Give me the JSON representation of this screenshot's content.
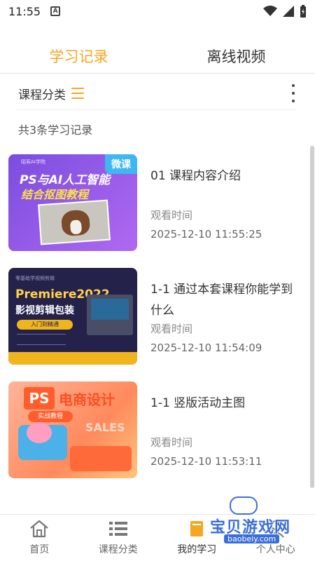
{
  "status_bar": {
    "time": "11:55",
    "notification_letter": "A"
  },
  "top_tabs": [
    {
      "label": "学习记录",
      "active": true
    },
    {
      "label": "离线视频",
      "active": false
    }
  ],
  "filter": {
    "label": "课程分类"
  },
  "record_count_text": "共3条学习记录",
  "records": [
    {
      "title": "01 课程内容介绍",
      "view_label": "观看时间",
      "view_time": "2025-12-10 11:55:25",
      "thumb": {
        "tag": "微课",
        "small": "陌客AI学院",
        "line1": "PS与AI人工智能",
        "line2": "结合抠图教程"
      }
    },
    {
      "title": "1-1 通过本套课程你能学到什么",
      "view_label": "观看时间",
      "view_time": "2025-12-10 11:54:09",
      "thumb": {
        "small": "零基础学视频剪辑",
        "line1": "Premiere2022",
        "line2": "影视剪辑包装",
        "pill": "入门到精通"
      }
    },
    {
      "title": "1-1 竖版活动主图",
      "view_label": "观看时间",
      "view_time": "2025-12-10 11:53:11",
      "thumb": {
        "ps": "PS",
        "line1": "电商设计",
        "pill": "实战教程",
        "sales": "SALES"
      }
    }
  ],
  "bottom_nav": [
    {
      "label": "首页",
      "icon": "home-icon"
    },
    {
      "label": "课程分类",
      "icon": "list-icon"
    },
    {
      "label": "我的学习",
      "icon": "book-icon",
      "active": true
    },
    {
      "label": "个人中心",
      "icon": "person-icon"
    }
  ],
  "watermark": {
    "text": "宝贝游戏网",
    "url": "baobeiy.com"
  },
  "colors": {
    "accent": "#f5a623",
    "tag_blue": "#3fb7f0",
    "watermark_blue": "#3b6fd8"
  }
}
